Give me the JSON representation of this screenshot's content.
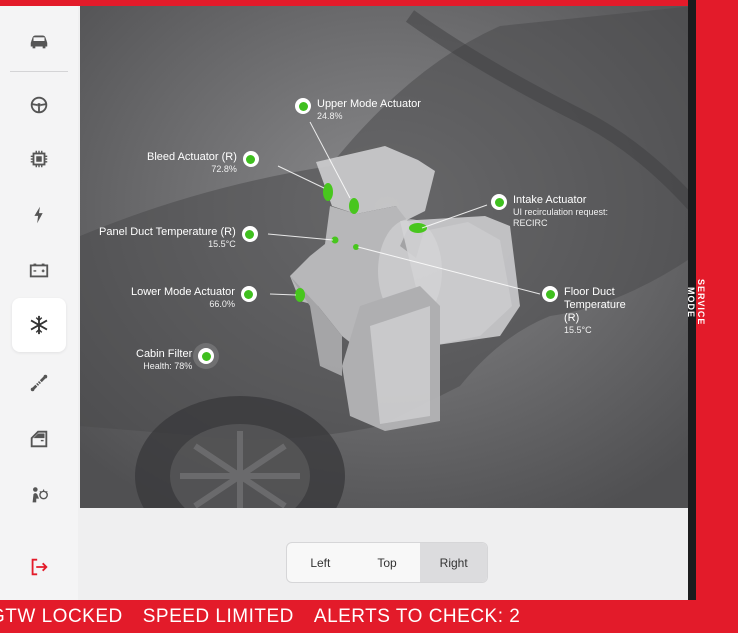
{
  "service_mode_label": "SERVICE MODE",
  "sidebar": {
    "items": [
      {
        "icon": "car-icon"
      },
      {
        "icon": "steering-wheel-icon"
      },
      {
        "icon": "chip-icon"
      },
      {
        "icon": "lightning-icon"
      },
      {
        "icon": "battery-icon"
      },
      {
        "icon": "snowflake-icon",
        "active": true
      },
      {
        "icon": "shock-absorber-icon"
      },
      {
        "icon": "door-icon"
      },
      {
        "icon": "airbag-icon"
      },
      {
        "icon": "exit-icon"
      }
    ]
  },
  "callouts": {
    "upper_mode": {
      "title": "Upper Mode Actuator",
      "value": "24.8%"
    },
    "bleed": {
      "title": "Bleed Actuator (R)",
      "value": "72.8%"
    },
    "intake": {
      "title": "Intake Actuator",
      "line1": "UI recirculation request:",
      "line2": "RECIRC"
    },
    "panel_duct": {
      "title": "Panel Duct Temperature (R)",
      "value": "15.5°C"
    },
    "floor_duct": {
      "title_line1": "Floor Duct",
      "title_line2": "Temperature",
      "title_line3": "(R)",
      "value": "15.5°C"
    },
    "lower_mode": {
      "title": "Lower Mode Actuator",
      "value": "66.0%"
    },
    "cabin_filter": {
      "title": "Cabin Filter",
      "value": "Health: 78%"
    }
  },
  "view_selector": {
    "options": [
      "Left",
      "Top",
      "Right"
    ],
    "selected": "Right"
  },
  "alerts": {
    "gtw": "GTW LOCKED",
    "speed": "SPEED LIMITED",
    "check": "ALERTS TO CHECK: 2"
  },
  "colors": {
    "service_red": "#e31b2a",
    "indicator_green": "#3fbf1f"
  }
}
